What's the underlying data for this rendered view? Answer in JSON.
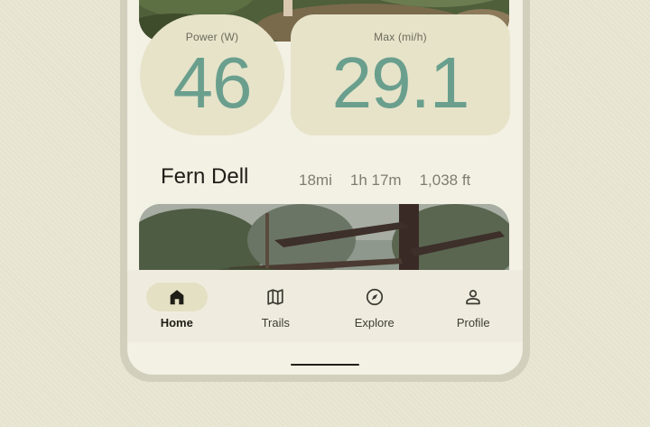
{
  "stats": {
    "power": {
      "label": "Power (W)",
      "value": "46"
    },
    "max": {
      "label": "Max (mi/h)",
      "value": "29.1"
    }
  },
  "trail": {
    "name": "Fern Dell",
    "distance": "18mi",
    "duration": "1h 17m",
    "elevation": "1,038 ft"
  },
  "nav": {
    "items": [
      {
        "label": "Home",
        "icon": "home-icon",
        "active": true
      },
      {
        "label": "Trails",
        "icon": "map-icon",
        "active": false
      },
      {
        "label": "Explore",
        "icon": "compass-icon",
        "active": false
      },
      {
        "label": "Profile",
        "icon": "person-icon",
        "active": false
      }
    ]
  },
  "colors": {
    "accent": "#6a9f8e",
    "tile": "#e6e3c9",
    "background": "#f3f0e4",
    "active_pill": "#e4e0c4"
  }
}
